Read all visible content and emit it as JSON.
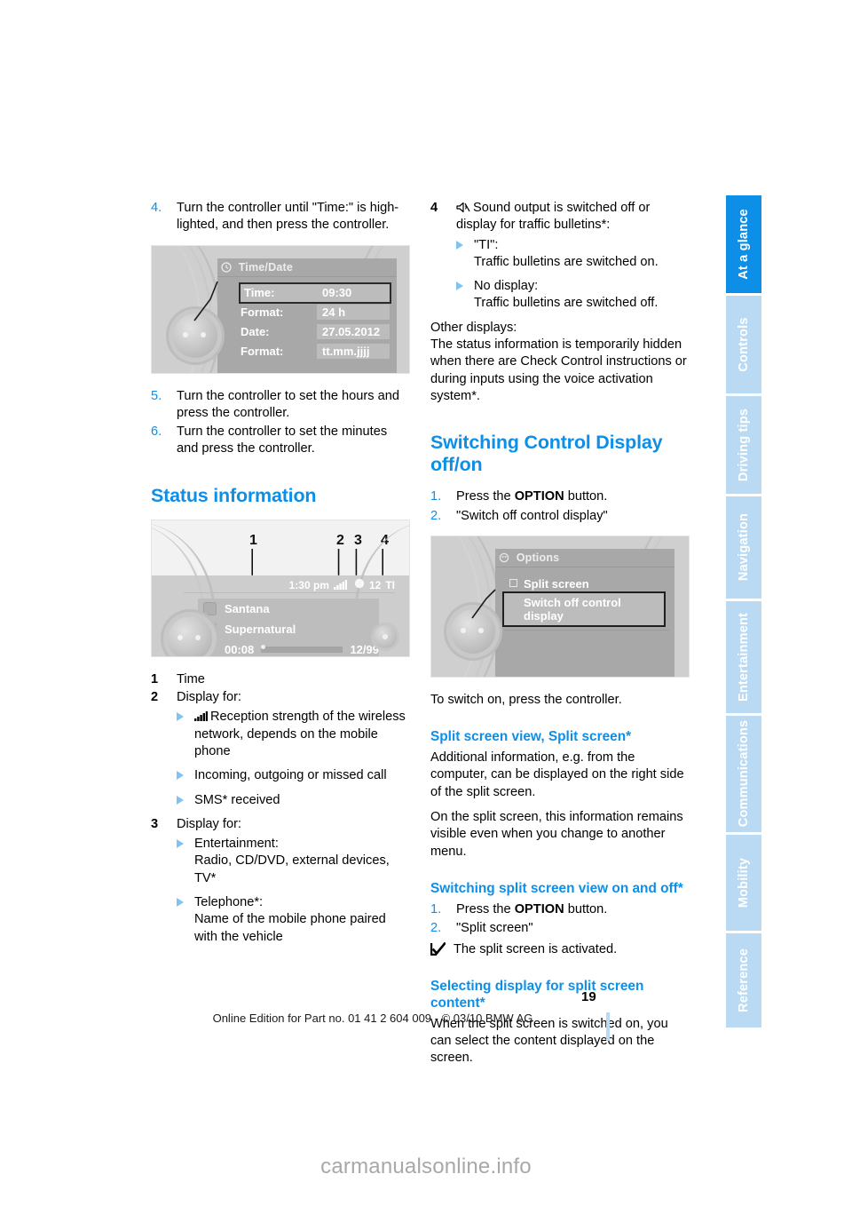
{
  "page": {
    "number": "19",
    "footer_note": "Online Edition for Part no. 01 41 2 604 009 - © 03/10 BMW AG",
    "watermark": "carmanualsonline.info"
  },
  "sidebar": {
    "tabs": [
      {
        "label": "At a glance",
        "active": true
      },
      {
        "label": "Controls",
        "active": false
      },
      {
        "label": "Driving tips",
        "active": false
      },
      {
        "label": "Navigation",
        "active": false
      },
      {
        "label": "Entertainment",
        "active": false
      },
      {
        "label": "Communications",
        "active": false
      },
      {
        "label": "Mobility",
        "active": false
      },
      {
        "label": "Reference",
        "active": false
      }
    ]
  },
  "left_column": {
    "step4": {
      "num": "4.",
      "text": "Turn the controller until \"Time:\" is high-lighted, and then press the controller."
    },
    "figure_timedate": {
      "title": "Time/Date",
      "rows": [
        {
          "key": "Time:",
          "value": "09:30",
          "selected": true
        },
        {
          "key": "Format:",
          "value": "24 h",
          "selected": false
        },
        {
          "key": "Date:",
          "value": "27.05.2012",
          "selected": false
        },
        {
          "key": "Format:",
          "value": "tt.mm.jjjj",
          "selected": false
        }
      ]
    },
    "step5": {
      "num": "5.",
      "text": "Turn the controller to set the hours and press the controller."
    },
    "step6": {
      "num": "6.",
      "text": "Turn the controller to set the minutes and press the controller."
    },
    "heading_status": "Status information",
    "figure_status": {
      "callouts": [
        "1",
        "2",
        "3",
        "4"
      ],
      "status_bar": {
        "time": "1:30 pm",
        "signal": "signal-bars-icon",
        "clock": "12",
        "ti": "TI"
      },
      "track": {
        "artist": "Santana",
        "album": "Supernatural",
        "elapsed": "00:08",
        "position": "12/99"
      }
    },
    "legend": [
      {
        "num": "1",
        "label": "Time",
        "bullets": []
      },
      {
        "num": "2",
        "label": "Display for:",
        "bullets": [
          {
            "icon": "signal-bars-icon",
            "text": "Reception strength of the wireless network, depends on the mobile phone"
          },
          {
            "icon": "",
            "text": "Incoming, outgoing or missed call"
          },
          {
            "icon": "",
            "text": "SMS* received"
          }
        ]
      },
      {
        "num": "3",
        "label": "Display for:",
        "bullets": [
          {
            "icon": "",
            "text": "Entertainment:\nRadio, CD/DVD, external devices, TV*"
          },
          {
            "icon": "",
            "text": "Telephone*:\nName of the mobile phone paired with the vehicle"
          }
        ]
      }
    ]
  },
  "right_column": {
    "legend4": {
      "num": "4",
      "icon": "mute-speaker-icon",
      "label": "Sound output is switched off or display for traffic bulletins*:",
      "bullets": [
        {
          "text": "\"TI\":\nTraffic bulletins are switched on."
        },
        {
          "text": "No display:\nTraffic bulletins are switched off."
        }
      ]
    },
    "other_displays": {
      "title": "Other displays:",
      "body": "The status information is temporarily hidden when there are Check Control instructions or during inputs using the voice activation system*."
    },
    "heading_switching": "Switching Control Display off/on",
    "steps": [
      {
        "num": "1.",
        "pre": "Press the ",
        "bold": "OPTION",
        "post": " button."
      },
      {
        "num": "2.",
        "pre": "\"Switch off control display\"",
        "bold": "",
        "post": ""
      }
    ],
    "figure_options": {
      "title": "Options",
      "items": [
        {
          "label": "Split screen",
          "checkbox": true,
          "selected": false
        },
        {
          "label": "Switch off control display",
          "checkbox": false,
          "selected": true
        }
      ]
    },
    "switch_on_note": "To switch on, press the controller.",
    "heading_splitscreen": "Split screen view, Split screen*",
    "splitscreen_body1": "Additional information, e.g. from the computer, can be displayed on the right side of the split screen.",
    "splitscreen_body2": "On the split screen, this information remains visible even when you change to another menu.",
    "heading_switching_split": "Switching split screen view on and off*",
    "split_steps": [
      {
        "num": "1.",
        "pre": "Press the ",
        "bold": "OPTION",
        "post": " button."
      },
      {
        "num": "2.",
        "pre": "\"Split screen\"",
        "bold": "",
        "post": ""
      }
    ],
    "split_result": "The split screen is activated.",
    "heading_selecting": "Selecting display for split screen content*",
    "selecting_body": "When the split screen is switched on, you can select the content displayed on the screen."
  }
}
